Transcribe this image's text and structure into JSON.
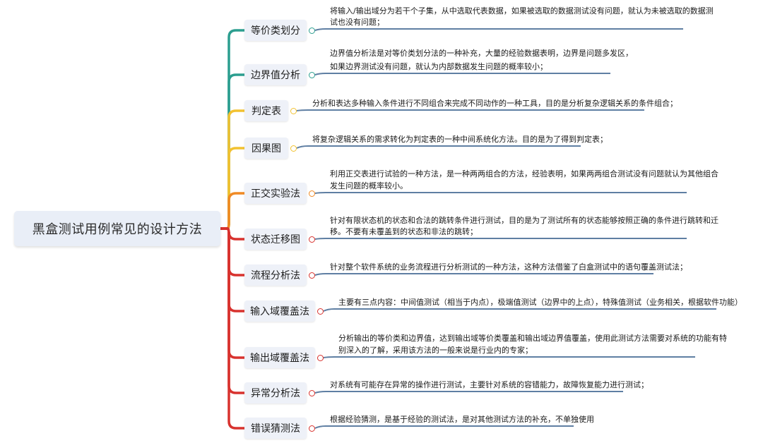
{
  "root": {
    "label": "黑盒测试用例常见的设计方法"
  },
  "colors": {
    "teal": "#2b9e8f",
    "yellow": "#f2c230",
    "orange": "#f08a24",
    "red": "#d8322e",
    "underline": "#5f7fa3"
  },
  "branches": [
    {
      "label": "等价类划分",
      "color": "#2b9e8f",
      "lines": [
        "将输入/输出域分为若干个子集，从中选取代表数据，如果被选取的数据测试没有问题，就认为未被选取的数据测",
        "试也没有问题；"
      ]
    },
    {
      "label": "边界值分析",
      "color": "#2b9e8f",
      "lines": [
        "边界值分析法是对等价类划分法的一种补充，大量的经验数据表明，边界是问题多发区，",
        "如果边界测试没有问题，就认为内部数据发生问题的概率较小；"
      ]
    },
    {
      "label": "判定表",
      "color": "#f2c230",
      "lines": [
        "分析和表达多种输入条件进行不同组合来完成不同动作的一种工具，目的是分析复杂逻辑关系的条件组合；"
      ]
    },
    {
      "label": "因果图",
      "color": "#f2c230",
      "lines": [
        "将复杂逻辑关系的需求转化为判定表的一种中间系统化方法。目的是为了得到判定表；"
      ]
    },
    {
      "label": "正交实验法",
      "color": "#f08a24",
      "lines": [
        "利用正交表进行试验的一种方法，是一种两两组合的方法，经验表明，如果两两组合测试没有问题就认为其他组合",
        "发生问题的概率较小。"
      ]
    },
    {
      "label": "状态迁移图",
      "color": "#d8322e",
      "lines": [
        "针对有限状态机的状态和合法的跳转条件进行测试，目的是为了测试所有的状态能够按照正确的条件进行跳转和迁",
        "移。不要有未覆盖到的状态和非法的跳转；"
      ]
    },
    {
      "label": "流程分析法",
      "color": "#d8322e",
      "lines": [
        "针对整个软件系统的业务流程进行分析测试的一种方法，这种方法借鉴了白盒测试中的语句覆盖测试法；"
      ]
    },
    {
      "label": "输入域覆盖法",
      "color": "#d8322e",
      "lines": [
        "主要有三点内容：中间值测试（相当于内点），极端值测试（边界中的上点），特殊值测试（业务相关，根据软件功能）"
      ]
    },
    {
      "label": "输出域覆盖法",
      "color": "#d8322e",
      "lines": [
        "分析输出的等价类和边界值，达到输出域等价类覆盖和输出域边界值覆盖，使用此测试方法需要对系统的功能有特",
        "别深入的了解，采用该方法的一般来说是行业内的专家；"
      ]
    },
    {
      "label": "异常分析法",
      "color": "#d8322e",
      "lines": [
        "对系统有可能存在异常的操作进行测试，主要针对系统的容错能力，故障恢复能力进行测试；"
      ]
    },
    {
      "label": "错误猜测法",
      "color": "#d8322e",
      "lines": [
        "根据经验猜测，是基于经验的测试法，是对其他测试方法的补充，不单独使用"
      ]
    }
  ]
}
